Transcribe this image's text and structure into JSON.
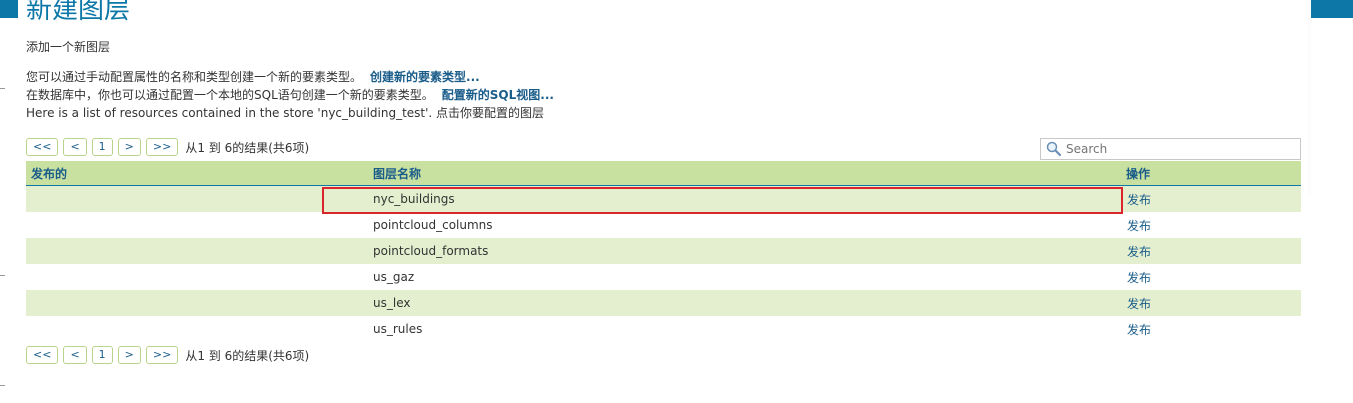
{
  "page": {
    "title": "新建图层",
    "subtitle": "添加一个新图层"
  },
  "intro": {
    "line1_text": "您可以通过手动配置属性的名称和类型创建一个新的要素类型。",
    "line1_link": "创建新的要素类型...",
    "line2_text": "在数据库中，你也可以通过配置一个本地的SQL语句创建一个新的要素类型。",
    "line2_link": "配置新的SQL视图...",
    "line3_text": "Here is a list of resources contained in the store 'nyc_building_test'. 点击你要配置的图层"
  },
  "pager": {
    "first": "<<",
    "prev": "<",
    "current": "1",
    "next": ">",
    "last": ">>",
    "info": "从1 到 6的结果(共6项)"
  },
  "search": {
    "placeholder": "Search"
  },
  "table": {
    "headers": [
      "发布的",
      "图层名称",
      "操作"
    ],
    "rows": [
      {
        "published": "",
        "name": "nyc_buildings",
        "action": "发布"
      },
      {
        "published": "",
        "name": "pointcloud_columns",
        "action": "发布"
      },
      {
        "published": "",
        "name": "pointcloud_formats",
        "action": "发布"
      },
      {
        "published": "",
        "name": "us_gaz",
        "action": "发布"
      },
      {
        "published": "",
        "name": "us_lex",
        "action": "发布"
      },
      {
        "published": "",
        "name": "us_rules",
        "action": "发布"
      }
    ]
  },
  "colors": {
    "title": "#0d78a8",
    "header_bg": "#c8e0a0",
    "row_odd_bg": "#e3efcf",
    "link": "#1b5d8a",
    "highlight": "#d9262c"
  }
}
